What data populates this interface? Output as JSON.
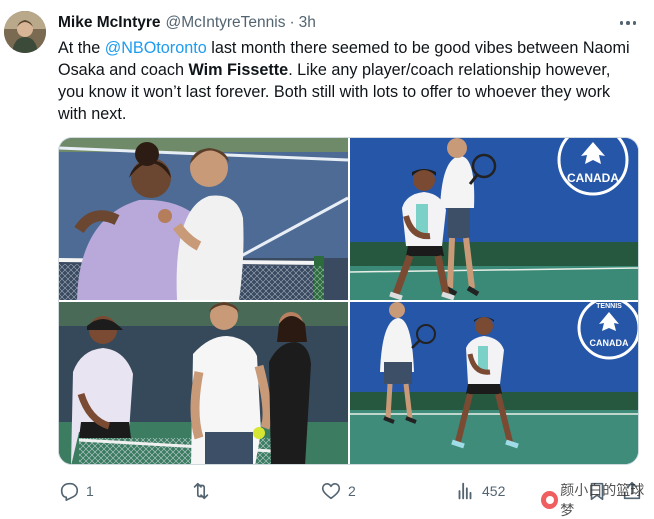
{
  "tweet": {
    "author_name": "Mike McIntyre",
    "author_handle": "@McIntyreTennis",
    "separator": "·",
    "time": "3h",
    "text": {
      "part1": "At the ",
      "mention": "@NBOtoronto",
      "part2": " last month there seemed to be good vibes between Naomi Osaka and coach ",
      "bold": "Wim Fissette",
      "part3": ". Like any player/coach relationship however, you know it won’t last forever. Both still with lots to offer to whoever they work with next."
    },
    "photos": {
      "photo2_sign": "CANADA",
      "photo4_sign": "CANADA",
      "photo4_sign_top": "TENNIS"
    }
  },
  "actions": {
    "replies": "1",
    "retweets": "",
    "likes": "2",
    "views": "452"
  },
  "icons": {
    "more": "more-horizontal-icon",
    "reply": "reply-icon",
    "retweet": "retweet-icon",
    "like": "heart-icon",
    "views": "views-bar-chart-icon",
    "bookmark": "bookmark-icon",
    "share": "share-icon"
  },
  "watermark": {
    "text": "颜小白的篮球梦"
  },
  "colors": {
    "text": "#0f1419",
    "secondary": "#536471",
    "link": "#1d9bf0",
    "border": "#cfd9de"
  }
}
